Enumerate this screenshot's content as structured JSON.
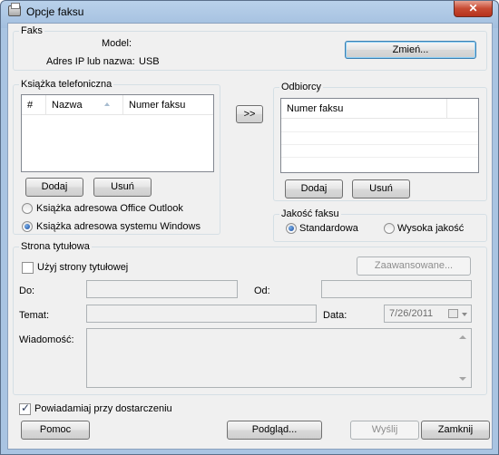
{
  "window": {
    "title": "Opcje faksu",
    "close_glyph": "✕"
  },
  "fax": {
    "group_title": "Faks",
    "model_label": "Model:",
    "model_value": "",
    "address_label": "Adres IP lub nazwa:",
    "address_value": "USB",
    "change_button": "Zmień..."
  },
  "phonebook": {
    "group_title": "Książka telefoniczna",
    "columns": [
      "#",
      "Nazwa",
      "Numer faksu"
    ],
    "rows": [],
    "add_button": "Dodaj",
    "remove_button": "Usuń",
    "source_options": [
      {
        "label": "Książka adresowa Office Outlook",
        "checked": false
      },
      {
        "label": "Książka adresowa systemu Windows",
        "checked": true
      }
    ]
  },
  "transfer_button": ">>",
  "recipients": {
    "group_title": "Odbiorcy",
    "columns": [
      "Numer faksu"
    ],
    "rows": [],
    "add_button": "Dodaj",
    "remove_button": "Usuń"
  },
  "quality": {
    "group_title": "Jakość faksu",
    "options": [
      {
        "label": "Standardowa",
        "checked": true
      },
      {
        "label": "Wysoka jakość",
        "checked": false
      }
    ]
  },
  "cover_page": {
    "group_title": "Strona tytułowa",
    "use_cover_label": "Użyj strony tytułowej",
    "use_cover_checked": false,
    "advanced_button": "Zaawansowane...",
    "to_label": "Do:",
    "to_value": "",
    "from_label": "Od:",
    "from_value": "",
    "subject_label": "Temat:",
    "subject_value": "",
    "date_label": "Data:",
    "date_value": "7/26/2011",
    "message_label": "Wiadomość:",
    "message_value": ""
  },
  "notify": {
    "label": "Powiadamiaj przy dostarczeniu",
    "checked": true
  },
  "footer": {
    "help_button": "Pomoc",
    "preview_button": "Podgląd...",
    "send_button": "Wyślij",
    "close_button": "Zamknij"
  }
}
